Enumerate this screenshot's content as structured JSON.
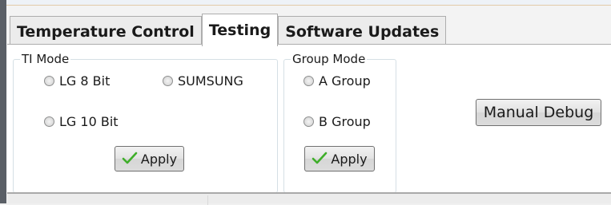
{
  "tabs": [
    {
      "label": "Temperature Control",
      "active": false
    },
    {
      "label": "Testing",
      "active": true
    },
    {
      "label": "Software Updates",
      "active": false
    }
  ],
  "ti_mode": {
    "title": "TI Mode",
    "options": [
      "LG 8 Bit",
      "SUMSUNG",
      "LG 10 Bit"
    ],
    "apply_label": "Apply"
  },
  "group_mode": {
    "title": "Group Mode",
    "options": [
      "A Group",
      "B Group"
    ],
    "apply_label": "Apply"
  },
  "manual_debug_label": "Manual Debug",
  "colors": {
    "check_icon": "#3fae2a",
    "groupbox_border": "#d5dfe5"
  },
  "icons": {
    "apply": "check-icon"
  }
}
